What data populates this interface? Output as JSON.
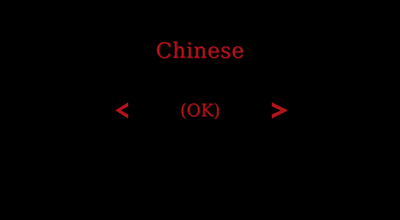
{
  "language_select": {
    "language": "Chinese",
    "status": "(OK)",
    "accent_color": "#b3141c",
    "previous_icon": "chevron-left-icon",
    "next_icon": "chevron-right-icon"
  }
}
